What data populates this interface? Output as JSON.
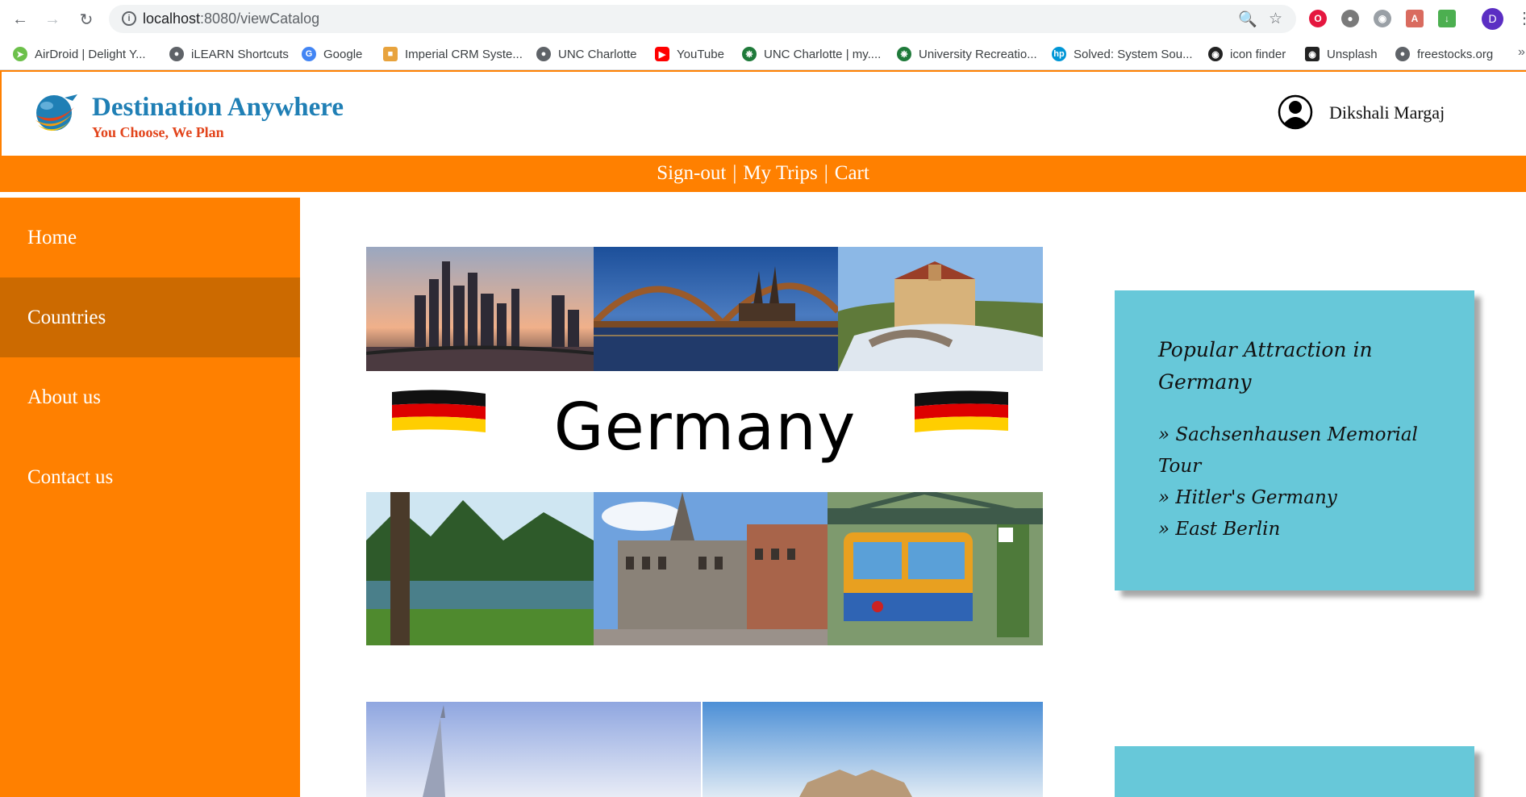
{
  "browser": {
    "url_host": "localhost",
    "url_path": ":8080/viewCatalog",
    "profile_initial": "D",
    "bookmarks": [
      {
        "label": "AirDroid | Delight Y...",
        "icon": "airdroid-icon",
        "color": "#6cc04a"
      },
      {
        "label": "iLEARN Shortcuts",
        "icon": "globe-icon",
        "color": "#5f6368"
      },
      {
        "label": "Google",
        "icon": "google-icon",
        "color": "#4285f4"
      },
      {
        "label": "Imperial CRM Syste...",
        "icon": "crm-icon",
        "color": "#e8a33d"
      },
      {
        "label": "UNC Charlotte",
        "icon": "globe-icon",
        "color": "#5f6368"
      },
      {
        "label": "YouTube",
        "icon": "youtube-icon",
        "color": "#ff0000"
      },
      {
        "label": "UNC Charlotte | my....",
        "icon": "unc-icon",
        "color": "#1f7a3a"
      },
      {
        "label": "University Recreatio...",
        "icon": "unc-icon",
        "color": "#1f7a3a"
      },
      {
        "label": "Solved: System Sou...",
        "icon": "hp-icon",
        "color": "#0096d6"
      },
      {
        "label": "icon finder",
        "icon": "iconfinder-icon",
        "color": "#222222"
      },
      {
        "label": "Unsplash",
        "icon": "camera-icon",
        "color": "#222222"
      },
      {
        "label": "freestocks.org",
        "icon": "globe-icon",
        "color": "#5f6368"
      }
    ]
  },
  "header": {
    "brand_title": "Destination Anywhere",
    "brand_tagline": "You Choose, We Plan",
    "user_name": "Dikshali  Margaj"
  },
  "topnav": {
    "signout": "Sign-out",
    "mytrips": "My Trips",
    "cart": "Cart",
    "separator": "|"
  },
  "sidebar": {
    "items": [
      {
        "label": "Home",
        "active": false
      },
      {
        "label": "Countries",
        "active": true
      },
      {
        "label": "About us",
        "active": false
      },
      {
        "label": "Contact us",
        "active": false
      }
    ]
  },
  "catalog": {
    "country_name": "Germany",
    "note_title": "Popular Attraction in Germany",
    "attractions": [
      "Sachsenhausen Memorial Tour",
      "Hitler's Germany",
      "East Berlin"
    ]
  },
  "colors": {
    "accent": "#ff8000",
    "sidebar_active": "#cc6a00",
    "note": "#67c8d9",
    "brand_blue": "#1f7fb5",
    "brand_red": "#e2441b"
  }
}
